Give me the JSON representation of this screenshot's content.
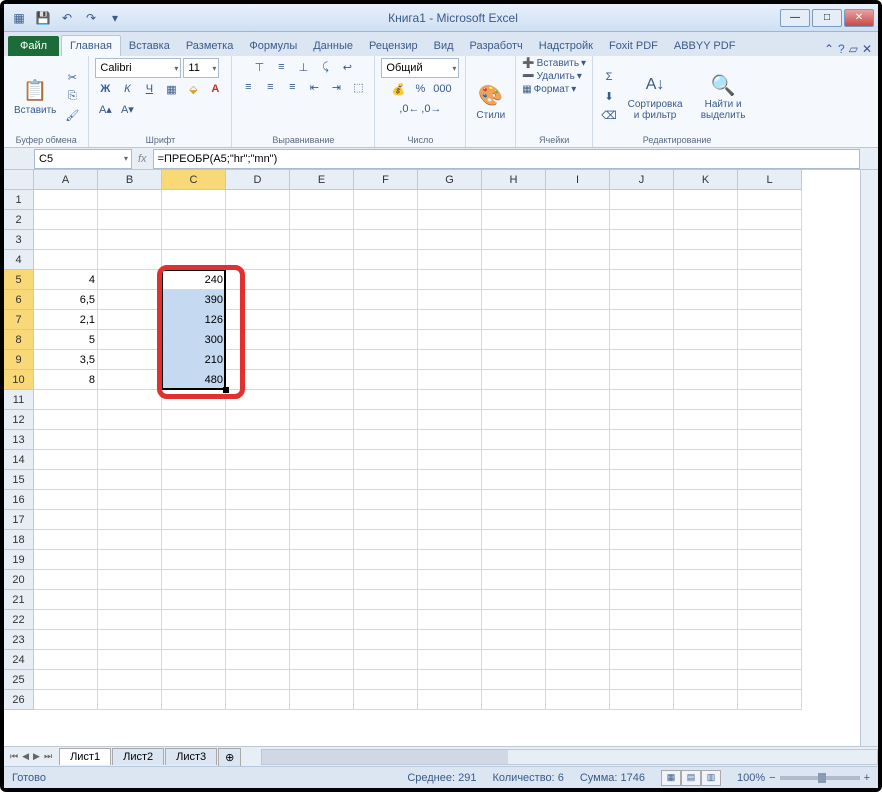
{
  "title": "Книга1  -  Microsoft Excel",
  "tabs": {
    "file": "Файл",
    "items": [
      "Главная",
      "Вставка",
      "Разметка",
      "Формулы",
      "Данные",
      "Рецензир",
      "Вид",
      "Разработч",
      "Надстройк",
      "Foxit PDF",
      "ABBYY PDF"
    ],
    "active": 0
  },
  "ribbon": {
    "clipboard": {
      "label": "Буфер обмена",
      "paste": "Вставить"
    },
    "font": {
      "label": "Шрифт",
      "name": "Calibri",
      "size": "11"
    },
    "align": {
      "label": "Выравнивание"
    },
    "number": {
      "label": "Число",
      "format": "Общий"
    },
    "styles": {
      "label": "Стили"
    },
    "cells": {
      "label": "Ячейки",
      "insert": "Вставить",
      "delete": "Удалить",
      "format": "Формат"
    },
    "editing": {
      "label": "Редактирование",
      "sort": "Сортировка и фильтр",
      "find": "Найти и выделить"
    }
  },
  "namebox": "C5",
  "formula": "=ПРЕОБР(A5;\"hr\";\"mn\")",
  "columns": [
    "A",
    "B",
    "C",
    "D",
    "E",
    "F",
    "G",
    "H",
    "I",
    "J",
    "K",
    "L"
  ],
  "selected_col": "C",
  "rows": 26,
  "selected_rows": [
    5,
    6,
    7,
    8,
    9,
    10
  ],
  "data_a": {
    "5": "4",
    "6": "6,5",
    "7": "2,1",
    "8": "5",
    "9": "3,5",
    "10": "8"
  },
  "data_c": {
    "5": "240",
    "6": "390",
    "7": "126",
    "8": "300",
    "9": "210",
    "10": "480"
  },
  "sheets": [
    "Лист1",
    "Лист2",
    "Лист3"
  ],
  "active_sheet": 0,
  "status": {
    "ready": "Готово",
    "avg_label": "Среднее:",
    "avg": "291",
    "count_label": "Количество:",
    "count": "6",
    "sum_label": "Сумма:",
    "sum": "1746",
    "zoom": "100%"
  }
}
